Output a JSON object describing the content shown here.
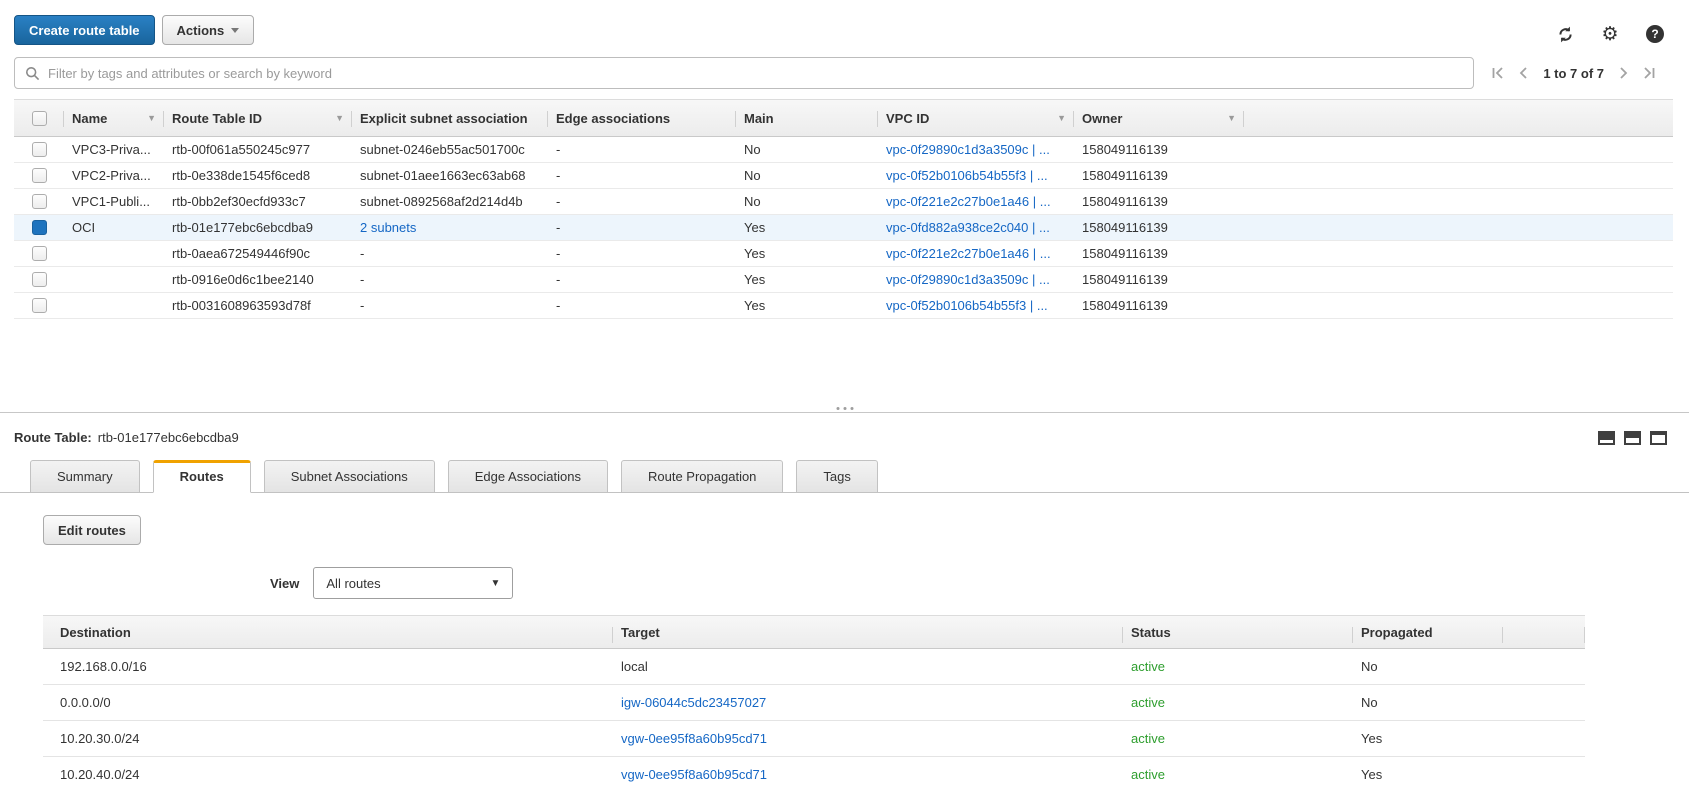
{
  "toolbar": {
    "create_button": "Create route table",
    "actions_button": "Actions"
  },
  "icons": {
    "gear_glyph": "⚙",
    "help_glyph": "?"
  },
  "filter": {
    "placeholder": "Filter by tags and attributes or search by keyword"
  },
  "pagination": {
    "range_label": "1 to 7 of 7"
  },
  "route_tables_table": {
    "columns": {
      "name": "Name",
      "route_table_id": "Route Table ID",
      "explicit_subnet_association": "Explicit subnet association",
      "edge_associations": "Edge associations",
      "main": "Main",
      "vpc_id": "VPC ID",
      "owner": "Owner"
    },
    "rows": [
      {
        "selected": false,
        "name": "VPC3-Priva...",
        "route_table_id": "rtb-00f061a550245c977",
        "explicit_subnet_association": "subnet-0246eb55ac501700c",
        "subnet_is_link": false,
        "edge_associations": "-",
        "main": "No",
        "vpc_id": "vpc-0f29890c1d3a3509c | ...",
        "owner": "158049116139"
      },
      {
        "selected": false,
        "name": "VPC2-Priva...",
        "route_table_id": "rtb-0e338de1545f6ced8",
        "explicit_subnet_association": "subnet-01aee1663ec63ab68",
        "subnet_is_link": false,
        "edge_associations": "-",
        "main": "No",
        "vpc_id": "vpc-0f52b0106b54b55f3 | ...",
        "owner": "158049116139"
      },
      {
        "selected": false,
        "name": "VPC1-Publi...",
        "route_table_id": "rtb-0bb2ef30ecfd933c7",
        "explicit_subnet_association": "subnet-0892568af2d214d4b",
        "subnet_is_link": false,
        "edge_associations": "-",
        "main": "No",
        "vpc_id": "vpc-0f221e2c27b0e1a46 | ...",
        "owner": "158049116139"
      },
      {
        "selected": true,
        "name": "OCI",
        "route_table_id": "rtb-01e177ebc6ebcdba9",
        "explicit_subnet_association": "2 subnets",
        "subnet_is_link": true,
        "edge_associations": "-",
        "main": "Yes",
        "vpc_id": "vpc-0fd882a938ce2c040 | ...",
        "owner": "158049116139"
      },
      {
        "selected": false,
        "name": "",
        "route_table_id": "rtb-0aea672549446f90c",
        "explicit_subnet_association": "-",
        "subnet_is_link": false,
        "edge_associations": "-",
        "main": "Yes",
        "vpc_id": "vpc-0f221e2c27b0e1a46 | ...",
        "owner": "158049116139"
      },
      {
        "selected": false,
        "name": "",
        "route_table_id": "rtb-0916e0d6c1bee2140",
        "explicit_subnet_association": "-",
        "subnet_is_link": false,
        "edge_associations": "-",
        "main": "Yes",
        "vpc_id": "vpc-0f29890c1d3a3509c | ...",
        "owner": "158049116139"
      },
      {
        "selected": false,
        "name": "",
        "route_table_id": "rtb-0031608963593d78f",
        "explicit_subnet_association": "-",
        "subnet_is_link": false,
        "edge_associations": "-",
        "main": "Yes",
        "vpc_id": "vpc-0f52b0106b54b55f3 | ...",
        "owner": "158049116139"
      }
    ]
  },
  "detail_panel": {
    "title_label": "Route Table:",
    "title_value": "rtb-01e177ebc6ebcdba9",
    "tabs": [
      "Summary",
      "Routes",
      "Subnet Associations",
      "Edge Associations",
      "Route Propagation",
      "Tags"
    ],
    "active_tab": "Routes",
    "edit_routes_button": "Edit routes",
    "view_label": "View",
    "view_selected": "All routes",
    "routes_table": {
      "columns": {
        "destination": "Destination",
        "target": "Target",
        "status": "Status",
        "propagated": "Propagated"
      },
      "rows": [
        {
          "destination": "192.168.0.0/16",
          "target": "local",
          "target_is_link": false,
          "status": "active",
          "propagated": "No"
        },
        {
          "destination": "0.0.0.0/0",
          "target": "igw-06044c5dc23457027",
          "target_is_link": true,
          "status": "active",
          "propagated": "No"
        },
        {
          "destination": "10.20.30.0/24",
          "target": "vgw-0ee95f8a60b95cd71",
          "target_is_link": true,
          "status": "active",
          "propagated": "Yes"
        },
        {
          "destination": "10.20.40.0/24",
          "target": "vgw-0ee95f8a60b95cd71",
          "target_is_link": true,
          "status": "active",
          "propagated": "Yes"
        }
      ]
    }
  },
  "colors": {
    "accent_blue": "#1d73b8",
    "link_blue": "#1567c5",
    "status_active_green": "#2e9e2e",
    "tab_active_orange": "#f0a200",
    "selected_row_bg": "#edf5fc"
  }
}
